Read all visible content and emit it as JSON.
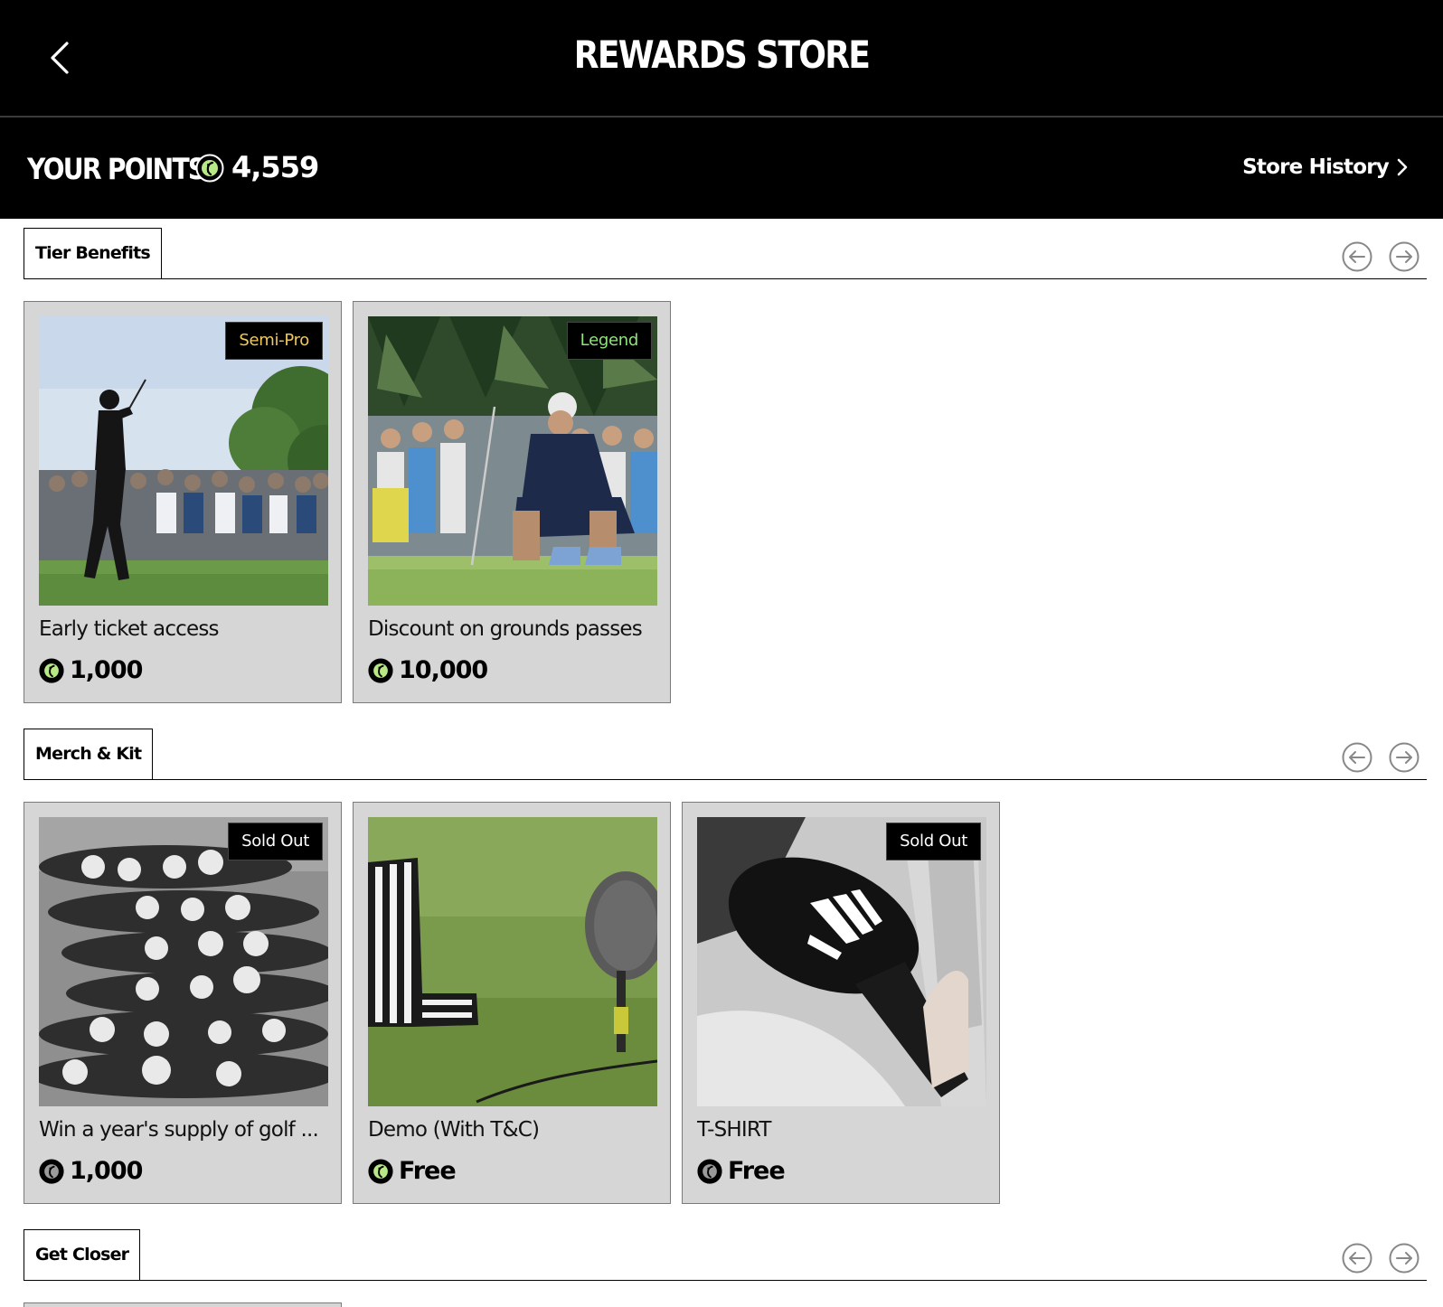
{
  "header": {
    "title": "REWARDS STORE",
    "back_icon": "chevron-left-icon"
  },
  "points": {
    "label": "YOUR POINTS",
    "value": "4,559",
    "store_history_label": "Store History",
    "coin_icon": "points-coin-icon"
  },
  "colors": {
    "header_bg": "#000000",
    "card_bg": "#d6d6d6",
    "badge_semi_pro": "#f0c75a",
    "badge_legend": "#8fe37a",
    "coin_accent": "#b8e986"
  },
  "sections": [
    {
      "label": "Tier Benefits",
      "items": [
        {
          "title": "Early ticket access",
          "price": "1,000",
          "badge": "Semi-Pro"
        },
        {
          "title": "Discount on grounds passes",
          "price": "10,000",
          "badge": "Legend"
        }
      ]
    },
    {
      "label": "Merch & Kit",
      "items": [
        {
          "title": "Win a year's supply of golf ...",
          "price": "1,000",
          "badge": "Sold Out"
        },
        {
          "title": "Demo (With T&C)",
          "price": "Free",
          "badge": ""
        },
        {
          "title": "T-SHIRT",
          "price": "Free",
          "badge": "Sold Out"
        }
      ]
    },
    {
      "label": "Get Closer",
      "items": []
    }
  ]
}
